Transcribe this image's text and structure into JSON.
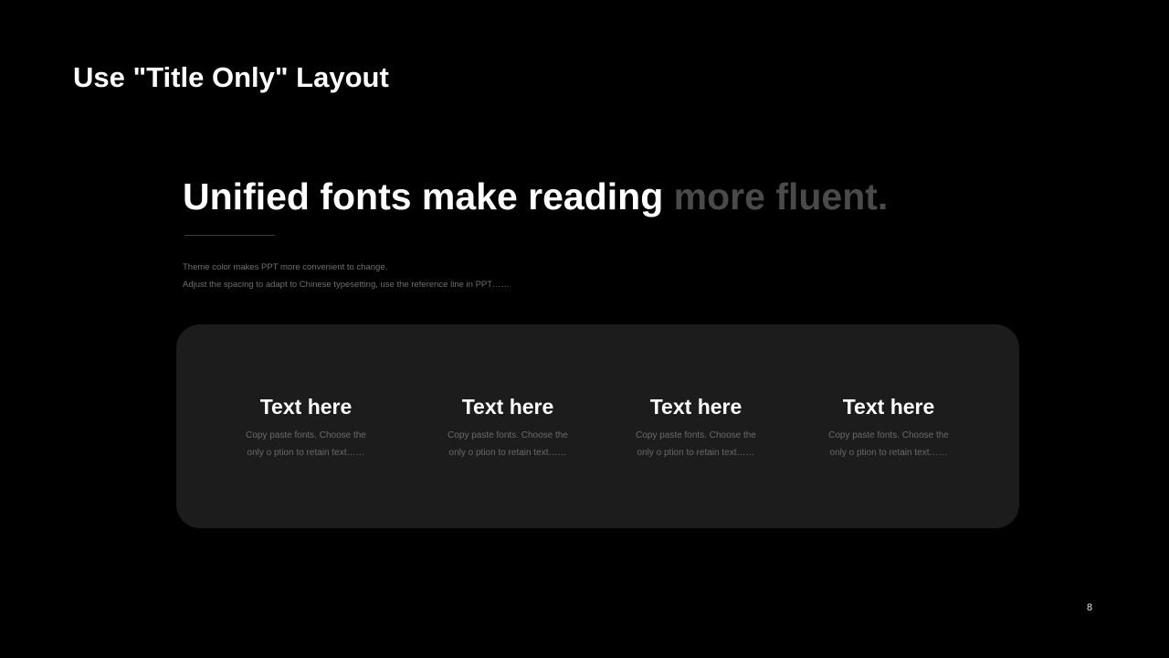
{
  "slide": {
    "title": "Use \"Title Only\" Layout",
    "page_number": "8"
  },
  "headline": {
    "part1": "Unified fonts make reading",
    "part2": "more fluent."
  },
  "subtext": {
    "line1": "Theme  color makes PPT more convenient  to change.",
    "line2": "Adjust  the spacing to adapt to Chinese typesetting,  use the  reference  line in PPT……"
  },
  "features": [
    {
      "title": "Text here",
      "desc_line1": "Copy paste fonts.  Choose the",
      "desc_line2": "only o ption to retain text……"
    },
    {
      "title": "Text here",
      "desc_line1": "Copy paste fonts.  Choose the",
      "desc_line2": "only o ption to retain text……"
    },
    {
      "title": "Text here",
      "desc_line1": "Copy paste fonts.  Choose the",
      "desc_line2": "only o ption to retain text……"
    },
    {
      "title": "Text here",
      "desc_line1": "Copy paste fonts.  Choose the",
      "desc_line2": "only o ption to retain text……"
    }
  ],
  "colors": {
    "background": "#000000",
    "panel": "#1c1c1c",
    "headline_accent_gray": "#4a4a4a",
    "body_text_gray": "#6f6f6f"
  }
}
